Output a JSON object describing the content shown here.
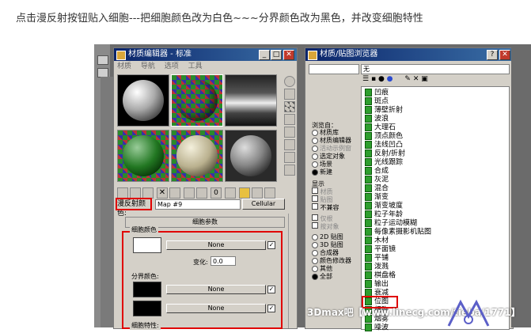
{
  "caption": "点击漫反射按钮贴入细胞---把细胞颜色改为白色~~~分界颜色改为黑色，并改变细胞特性",
  "material_editor": {
    "title": "材质编辑器 - 标准",
    "menu": [
      "材质",
      "导航",
      "选项",
      "工具"
    ],
    "diffuse_label": "漫反射颜色:",
    "map_value": "Map #9",
    "map_type_button": "Cellular",
    "rollout_title": "细胞参数",
    "cell_color_group": "细胞颜色",
    "none_label": "None",
    "variation_label": "变化:",
    "variation_value": "0.0",
    "division_group": "分界颜色:",
    "cell_char_group": "细胞特性:",
    "colors": {
      "cell": "#ffffff",
      "division": "#000000"
    }
  },
  "browser": {
    "title": "材质/贴图浏览器",
    "search_value": "无",
    "browse_from_title": "浏览自：",
    "browse_from": [
      {
        "label": "材质库",
        "on": false
      },
      {
        "label": "材质编辑器",
        "on": false
      },
      {
        "label": "活动示例窗",
        "on": false
      },
      {
        "label": "选定对象",
        "on": false
      },
      {
        "label": "场景",
        "on": false
      },
      {
        "label": "新建",
        "on": true
      }
    ],
    "show_title": "显示",
    "show": [
      "材质",
      "贴图",
      "不兼容"
    ],
    "extra": [
      "仅根",
      "按对象"
    ],
    "type_filters": [
      {
        "label": "2D 贴图",
        "on": false
      },
      {
        "label": "3D 贴图",
        "on": false
      },
      {
        "label": "合成器",
        "on": false
      },
      {
        "label": "颜色修改器",
        "on": false
      },
      {
        "label": "其他",
        "on": false
      },
      {
        "label": "全部",
        "on": true
      }
    ],
    "items": [
      "凹痕",
      "斑点",
      "薄壁折射",
      "波浪",
      "大理石",
      "顶点颜色",
      "法线凹凸",
      "反射/折射",
      "光线跟踪",
      "合成",
      "灰泥",
      "混合",
      "渐变",
      "渐变坡度",
      "粒子年龄",
      "粒子运动模糊",
      "每像素摄影机贴图",
      "木材",
      "平面镜",
      "平铺",
      "泼溅",
      "棋盘格",
      "输出",
      "衰减",
      "位图",
      "细胞",
      "烟雾",
      "噪波"
    ],
    "highlighted_item": "细胞"
  },
  "watermark": "3Dmax吧【www.linecg.com/tieba/1771】"
}
